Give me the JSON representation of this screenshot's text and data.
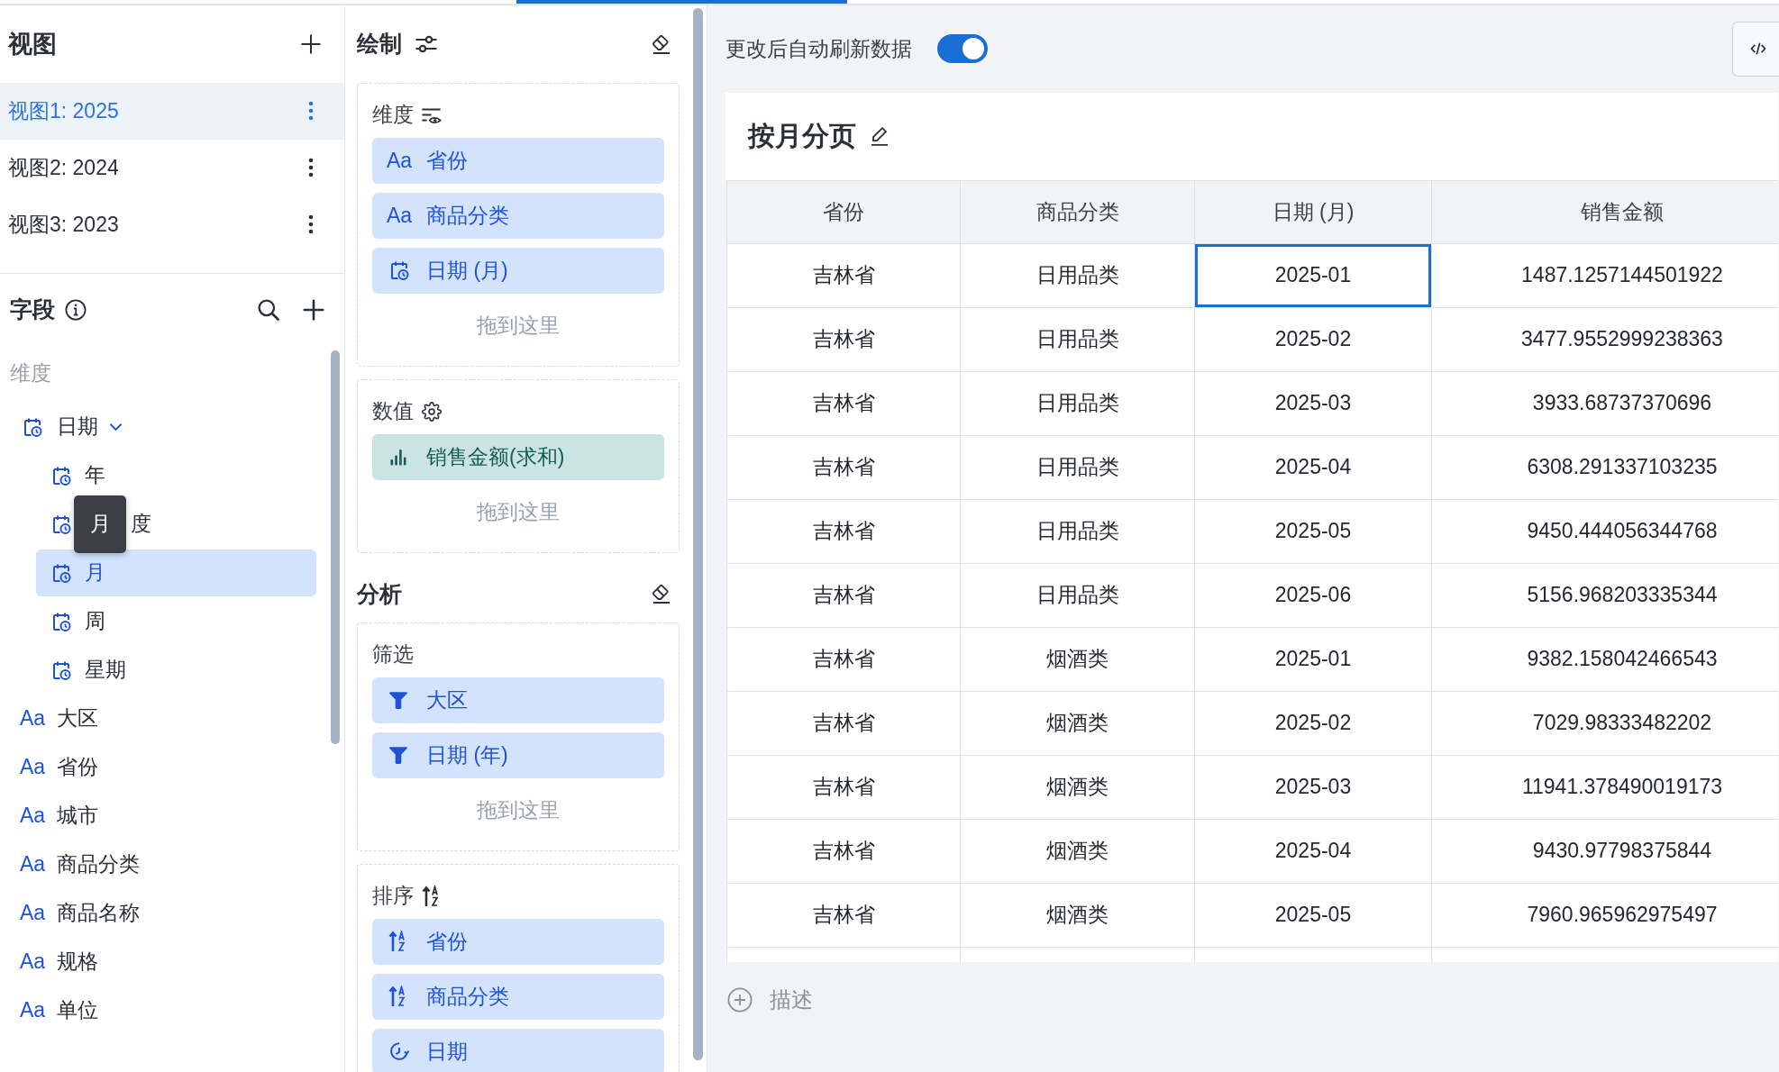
{
  "views": {
    "title": "视图",
    "items": [
      {
        "label": "视图1: 2025",
        "selected": true
      },
      {
        "label": "视图2: 2024",
        "selected": false
      },
      {
        "label": "视图3: 2023",
        "selected": false
      }
    ]
  },
  "fields": {
    "title": "字段",
    "group_label": "维度",
    "items": [
      {
        "kind": "date",
        "label": "日期",
        "expanded": true,
        "selected": false,
        "children": [
          {
            "kind": "date",
            "label": "年",
            "selected": false
          },
          {
            "kind": "date",
            "label": "度",
            "selected": false,
            "tooltip": "月"
          },
          {
            "kind": "date",
            "label": "月",
            "selected": true
          },
          {
            "kind": "date",
            "label": "周",
            "selected": false
          },
          {
            "kind": "date",
            "label": "星期",
            "selected": false
          }
        ]
      },
      {
        "kind": "text",
        "type_mark": "Aa",
        "label": "大区",
        "selected": false
      },
      {
        "kind": "text",
        "type_mark": "Aa",
        "label": "省份",
        "selected": false
      },
      {
        "kind": "text",
        "type_mark": "Aa",
        "label": "城市",
        "selected": false
      },
      {
        "kind": "text",
        "type_mark": "Aa",
        "label": "商品分类",
        "selected": false
      },
      {
        "kind": "text",
        "type_mark": "Aa",
        "label": "商品名称",
        "selected": false
      },
      {
        "kind": "text",
        "type_mark": "Aa",
        "label": "规格",
        "selected": false
      },
      {
        "kind": "text",
        "type_mark": "Aa",
        "label": "单位",
        "selected": false
      }
    ]
  },
  "draw": {
    "title": "绘制",
    "sections": [
      {
        "kind": "dimensions",
        "title": "维度",
        "chips": [
          {
            "kind": "text",
            "type_mark": "Aa",
            "label": "省份"
          },
          {
            "kind": "text",
            "type_mark": "Aa",
            "label": "商品分类"
          },
          {
            "kind": "date",
            "label": "日期 (月)"
          }
        ],
        "drop_hint": "拖到这里"
      },
      {
        "kind": "measures",
        "title": "数值",
        "chips": [
          {
            "kind": "measure",
            "label": "销售金额(求和)"
          }
        ],
        "drop_hint": "拖到这里"
      }
    ]
  },
  "analysis": {
    "title": "分析",
    "sections": [
      {
        "kind": "filters",
        "title": "筛选",
        "chips": [
          {
            "kind": "filter",
            "label": "大区"
          },
          {
            "kind": "filter",
            "label": "日期 (年)"
          }
        ],
        "drop_hint": "拖到这里"
      },
      {
        "kind": "sort",
        "title": "排序",
        "chips": [
          {
            "kind": "sort",
            "label": "省份"
          },
          {
            "kind": "sort",
            "label": "商品分类"
          },
          {
            "kind": "custom_sort",
            "label": "日期"
          }
        ]
      }
    ]
  },
  "auto_refresh": {
    "label": "更改后自动刷新数据",
    "on": true
  },
  "card": {
    "title": "按月分页",
    "table": {
      "columns": [
        "省份",
        "商品分类",
        "日期 (月)",
        "销售金额"
      ],
      "rows": [
        {
          "cells": [
            {
              "text": "吉林省",
              "selected": false
            },
            {
              "text": "日用品类",
              "selected": false
            },
            {
              "text": "2025-01",
              "selected": true
            },
            {
              "text": "1487.1257144501922",
              "selected": false
            }
          ]
        },
        {
          "cells": [
            {
              "text": "吉林省",
              "selected": false
            },
            {
              "text": "日用品类",
              "selected": false
            },
            {
              "text": "2025-02",
              "selected": false
            },
            {
              "text": "3477.9552999238363",
              "selected": false
            }
          ]
        },
        {
          "cells": [
            {
              "text": "吉林省",
              "selected": false
            },
            {
              "text": "日用品类",
              "selected": false
            },
            {
              "text": "2025-03",
              "selected": false
            },
            {
              "text": "3933.68737370696",
              "selected": false
            }
          ]
        },
        {
          "cells": [
            {
              "text": "吉林省",
              "selected": false
            },
            {
              "text": "日用品类",
              "selected": false
            },
            {
              "text": "2025-04",
              "selected": false
            },
            {
              "text": "6308.291337103235",
              "selected": false
            }
          ]
        },
        {
          "cells": [
            {
              "text": "吉林省",
              "selected": false
            },
            {
              "text": "日用品类",
              "selected": false
            },
            {
              "text": "2025-05",
              "selected": false
            },
            {
              "text": "9450.444056344768",
              "selected": false
            }
          ]
        },
        {
          "cells": [
            {
              "text": "吉林省",
              "selected": false
            },
            {
              "text": "日用品类",
              "selected": false
            },
            {
              "text": "2025-06",
              "selected": false
            },
            {
              "text": "5156.968203335344",
              "selected": false
            }
          ]
        },
        {
          "cells": [
            {
              "text": "吉林省",
              "selected": false
            },
            {
              "text": "烟酒类",
              "selected": false
            },
            {
              "text": "2025-01",
              "selected": false
            },
            {
              "text": "9382.158042466543",
              "selected": false
            }
          ]
        },
        {
          "cells": [
            {
              "text": "吉林省",
              "selected": false
            },
            {
              "text": "烟酒类",
              "selected": false
            },
            {
              "text": "2025-02",
              "selected": false
            },
            {
              "text": "7029.98333482202",
              "selected": false
            }
          ]
        },
        {
          "cells": [
            {
              "text": "吉林省",
              "selected": false
            },
            {
              "text": "烟酒类",
              "selected": false
            },
            {
              "text": "2025-03",
              "selected": false
            },
            {
              "text": "11941.378490019173",
              "selected": false
            }
          ]
        },
        {
          "cells": [
            {
              "text": "吉林省",
              "selected": false
            },
            {
              "text": "烟酒类",
              "selected": false
            },
            {
              "text": "2025-04",
              "selected": false
            },
            {
              "text": "9430.97798375844",
              "selected": false
            }
          ]
        },
        {
          "cells": [
            {
              "text": "吉林省",
              "selected": false
            },
            {
              "text": "烟酒类",
              "selected": false
            },
            {
              "text": "2025-05",
              "selected": false
            },
            {
              "text": "7960.965962975497",
              "selected": false
            }
          ]
        }
      ]
    }
  },
  "description": {
    "label": "描述"
  }
}
